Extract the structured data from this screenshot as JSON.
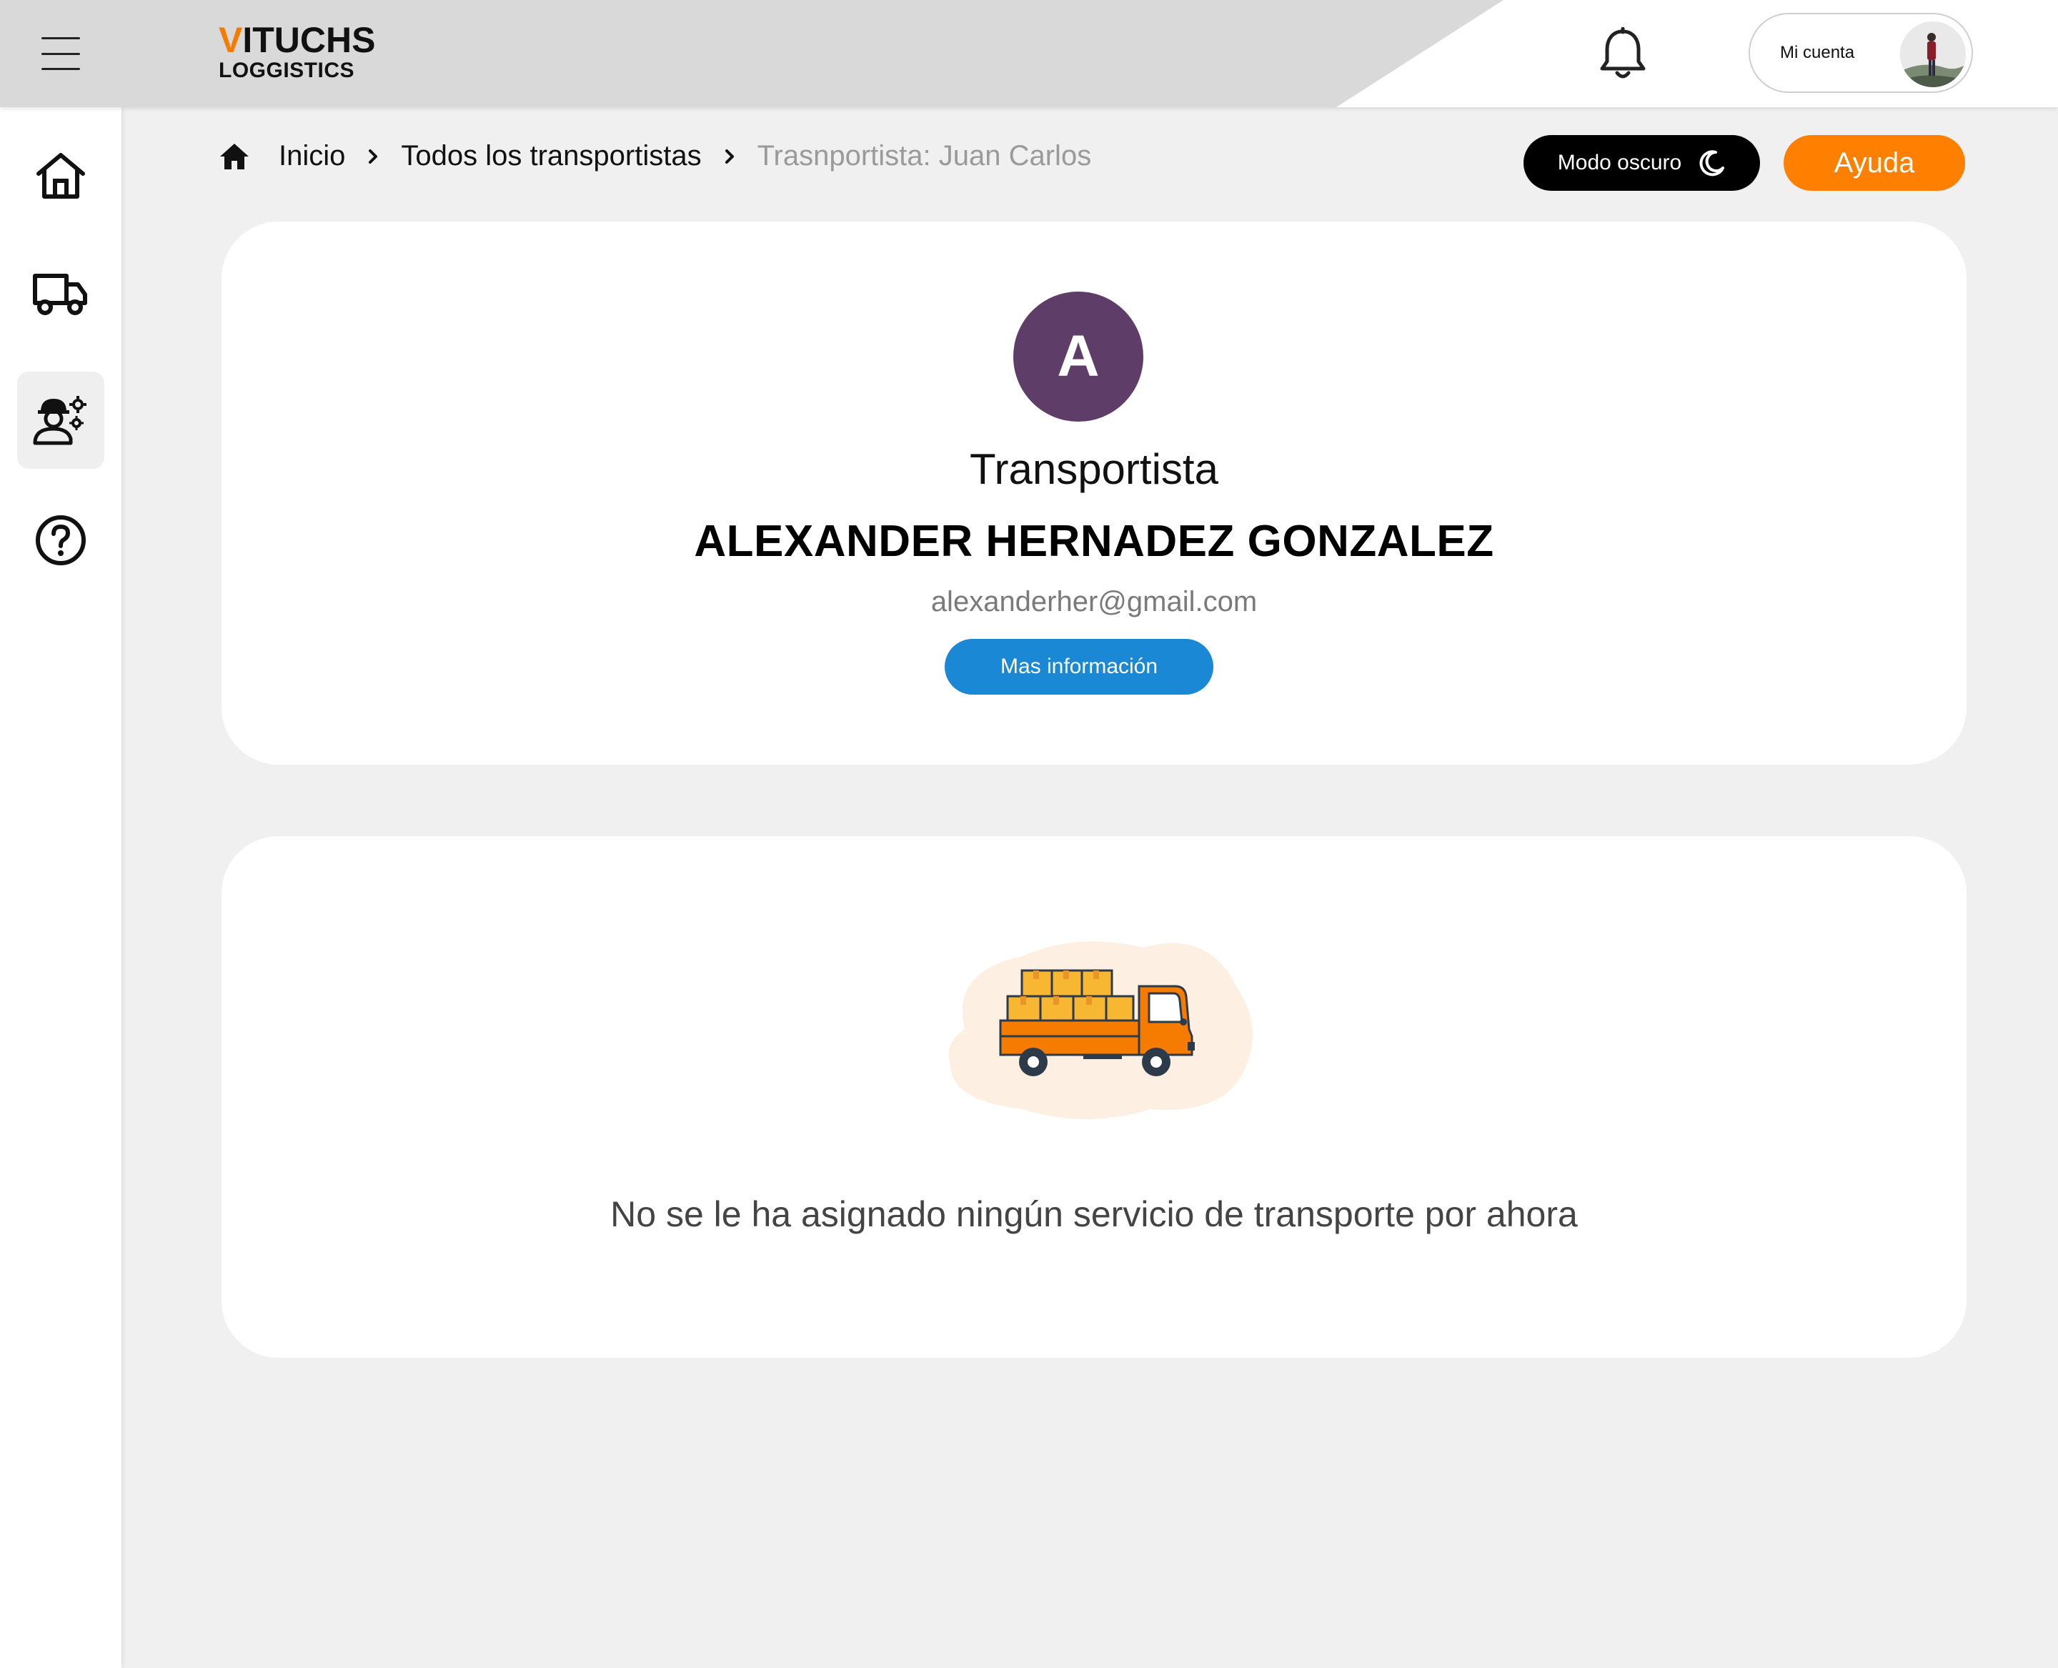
{
  "brand": {
    "first_letter": "V",
    "rest": "ITUCHS",
    "subtitle": "LOGGISTICS",
    "accent_color": "#f57c00"
  },
  "header": {
    "menu_icon": "hamburger-icon",
    "notification_icon": "bell-icon",
    "account_label": "Mi cuenta"
  },
  "sidebar": {
    "items": [
      {
        "icon": "home-icon",
        "active": false
      },
      {
        "icon": "truck-icon",
        "active": false
      },
      {
        "icon": "worker-settings-icon",
        "active": true
      },
      {
        "icon": "help-circle-icon",
        "active": false
      }
    ]
  },
  "breadcrumb": {
    "home_icon": "home-icon",
    "items": [
      "Inicio",
      "Todos los transportistas"
    ],
    "current": "Trasnportista: Juan Carlos"
  },
  "actions": {
    "dark_mode_label": "Modo oscuro",
    "dark_mode_icon": "moon-icon",
    "help_label": "Ayuda",
    "help_color": "#ff8000"
  },
  "profile": {
    "initial": "A",
    "avatar_color": "#5e3d68",
    "role": "Transportista",
    "name": "ALEXANDER HERNADEZ GONZALEZ",
    "email": "alexanderher@gmail.com",
    "more_info_label": "Mas información",
    "button_color": "#1a88d4"
  },
  "empty_state": {
    "illustration": "delivery-truck-illustration",
    "message": "No se le ha asignado ningún servicio de transporte por ahora"
  }
}
